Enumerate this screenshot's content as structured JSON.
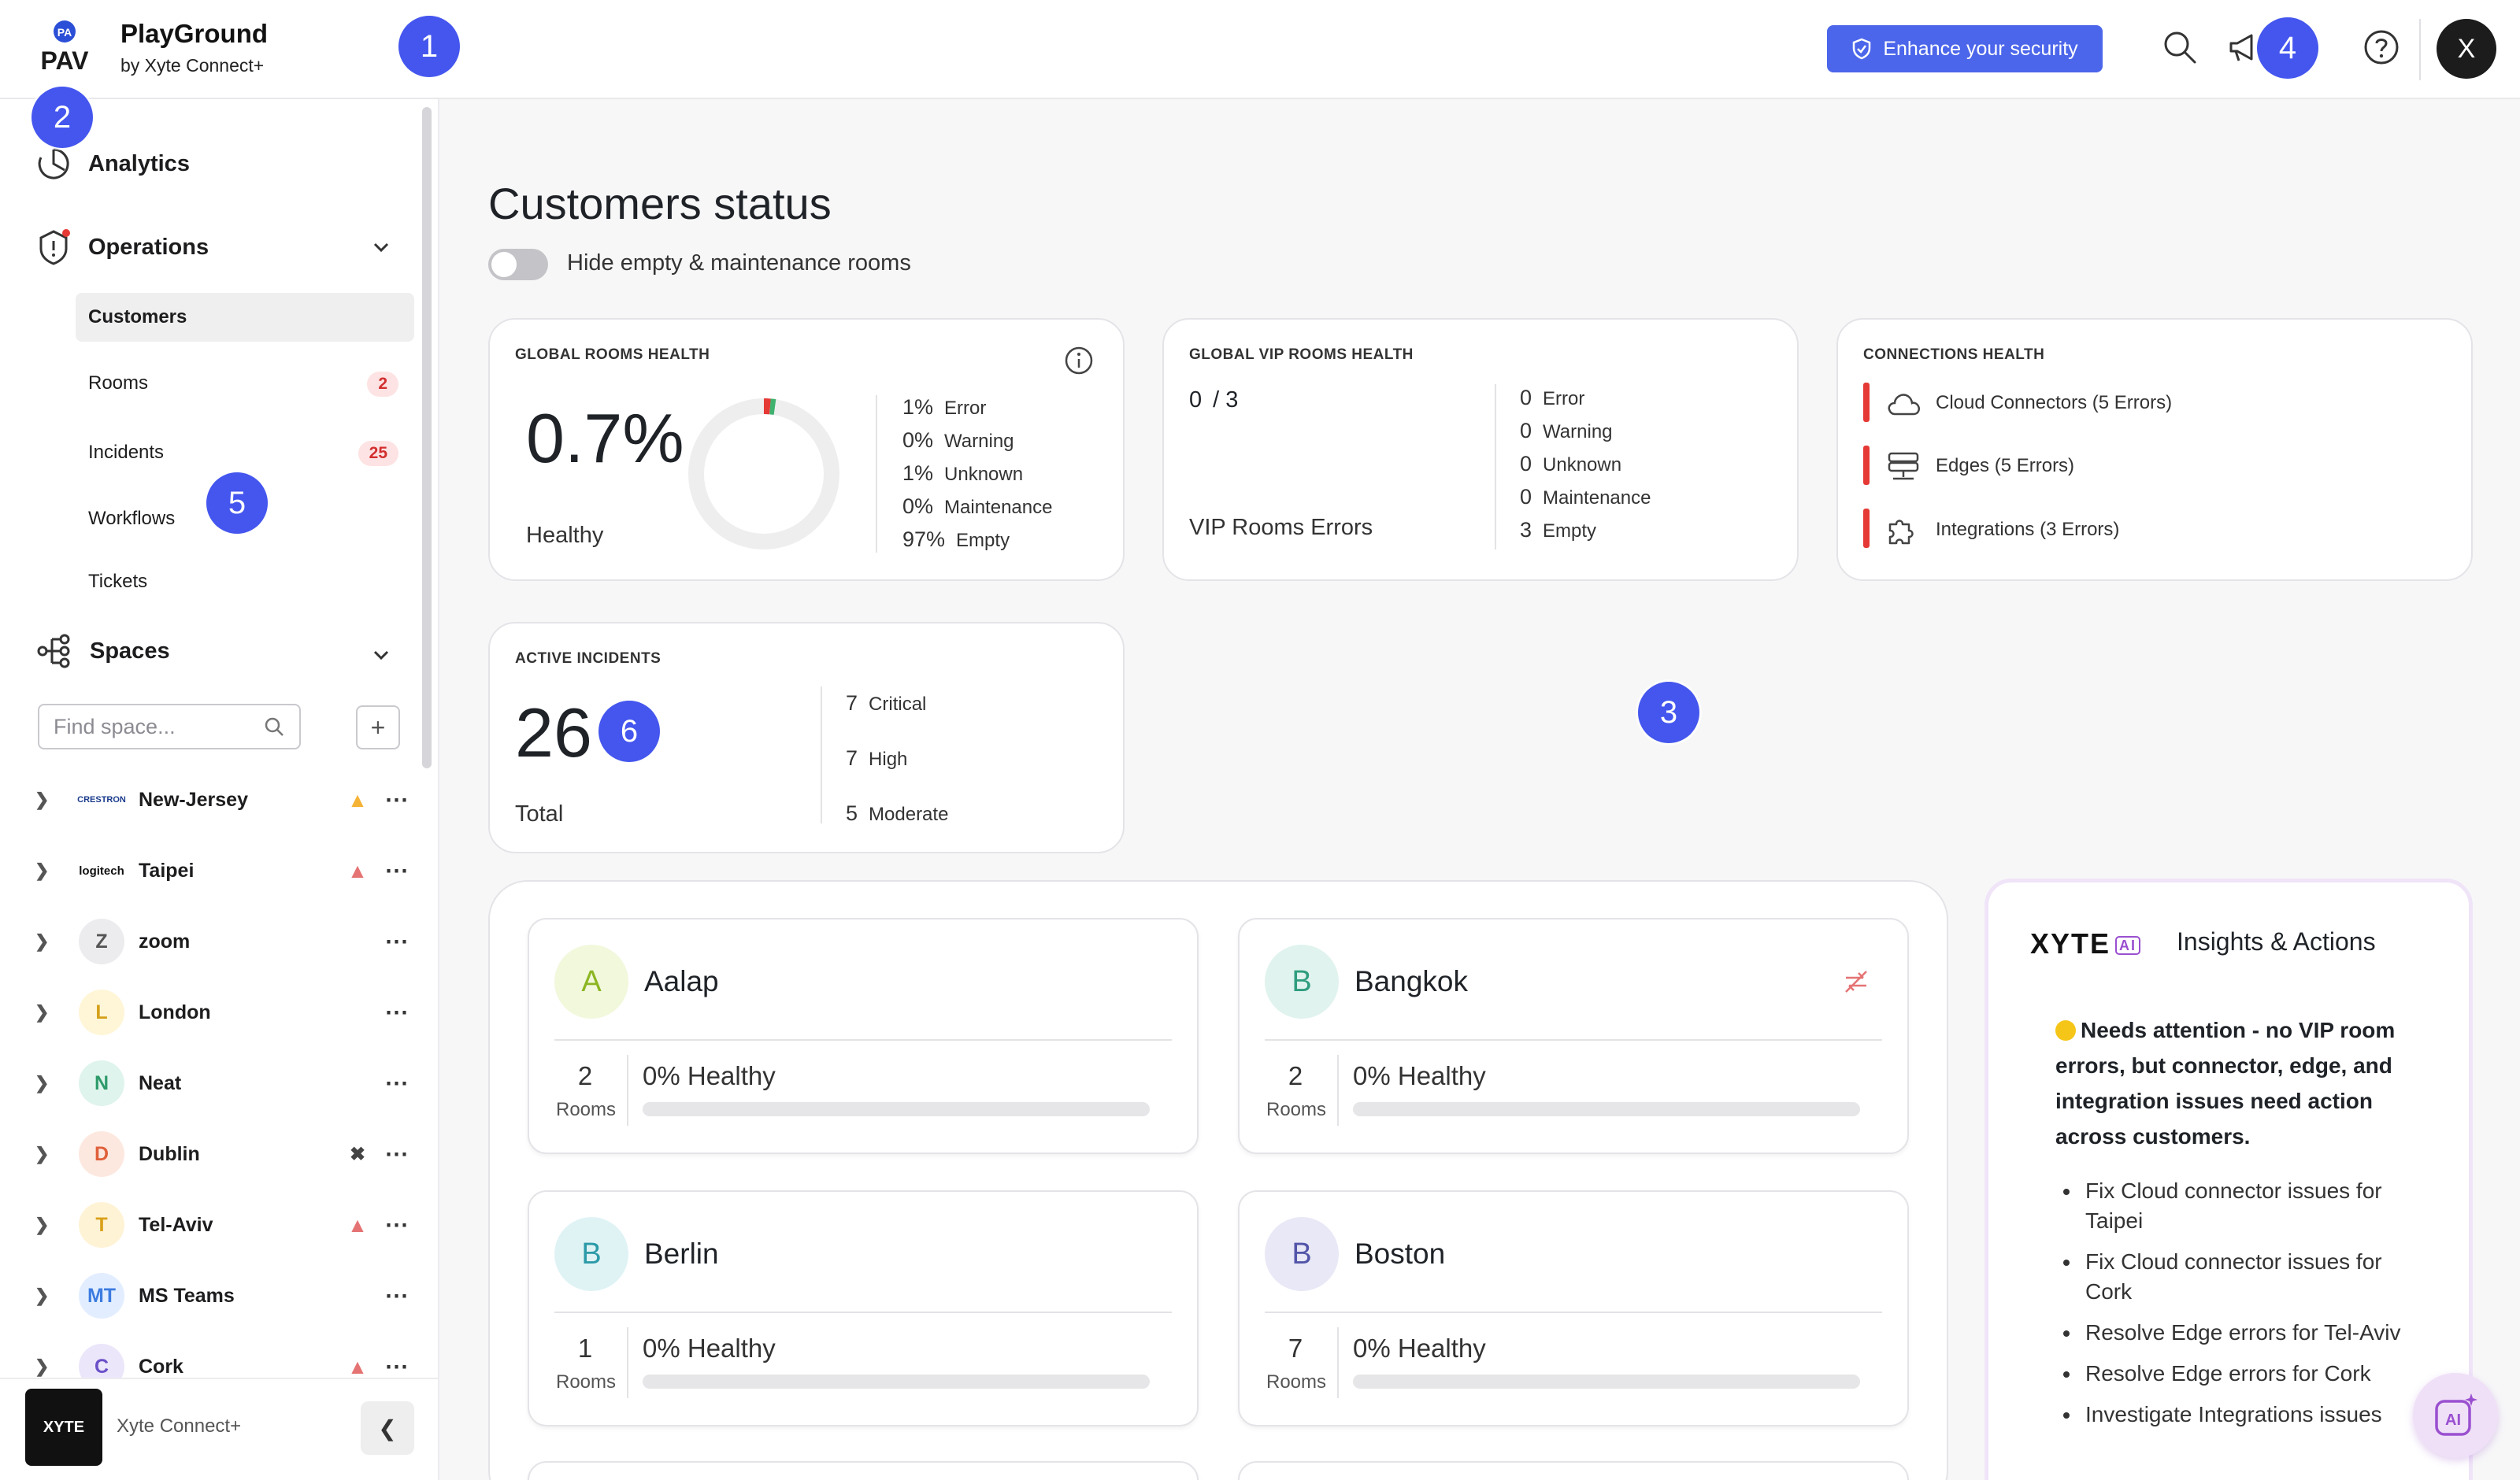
{
  "app": {
    "title": "PlayGround",
    "subtitle": "by Xyte Connect+",
    "logo_text": "PAV"
  },
  "topbar": {
    "enhance_label": "Enhance your security",
    "avatar_initial": "X",
    "icons": [
      "search-icon",
      "megaphone-icon",
      "bell-icon",
      "help-icon"
    ]
  },
  "badges": {
    "b1": "1",
    "b2": "2",
    "b3": "3",
    "b4": "4",
    "b5": "5",
    "b6": "6"
  },
  "sidebar": {
    "analytics": "Analytics",
    "operations": "Operations",
    "sub_items": [
      {
        "label": "Customers",
        "count": ""
      },
      {
        "label": "Rooms",
        "count": "2"
      },
      {
        "label": "Incidents",
        "count": "25"
      },
      {
        "label": "Workflows",
        "count": ""
      },
      {
        "label": "Tickets",
        "count": ""
      }
    ],
    "spaces": "Spaces",
    "find_placeholder": "Find space...",
    "space_items": [
      {
        "name": "New-Jersey",
        "avatar": "CRESTRON",
        "status": "warning"
      },
      {
        "name": "Taipei",
        "avatar": "logitech",
        "status": "error"
      },
      {
        "name": "zoom",
        "avatar": "Z",
        "status": ""
      },
      {
        "name": "London",
        "avatar": "L",
        "status": ""
      },
      {
        "name": "Neat",
        "avatar": "N",
        "status": ""
      },
      {
        "name": "Dublin",
        "avatar": "D",
        "status": "maintenance"
      },
      {
        "name": "Tel-Aviv",
        "avatar": "T",
        "status": "error"
      },
      {
        "name": "MS Teams",
        "avatar": "MT",
        "status": ""
      },
      {
        "name": "Cork",
        "avatar": "C",
        "status": "error"
      }
    ],
    "footer_logo": "XYTE",
    "footer_name": "Xyte Connect+"
  },
  "main": {
    "title": "Customers status",
    "toggle_label": "Hide empty & maintenance rooms",
    "global_rooms": {
      "title": "GLOBAL ROOMS HEALTH",
      "value": "0.7%",
      "label": "Healthy",
      "stats": [
        {
          "v": "1%",
          "k": "Error"
        },
        {
          "v": "0%",
          "k": "Warning"
        },
        {
          "v": "1%",
          "k": "Unknown"
        },
        {
          "v": "0%",
          "k": "Maintenance"
        },
        {
          "v": "97%",
          "k": "Empty"
        }
      ]
    },
    "vip_rooms": {
      "title": "GLOBAL VIP ROOMS HEALTH",
      "value": "0",
      "total": "/ 3",
      "label": "VIP Rooms Errors",
      "stats": [
        {
          "v": "0",
          "k": "Error"
        },
        {
          "v": "0",
          "k": "Warning"
        },
        {
          "v": "0",
          "k": "Unknown"
        },
        {
          "v": "0",
          "k": "Maintenance"
        },
        {
          "v": "3",
          "k": "Empty"
        }
      ]
    },
    "connections": {
      "title": "CONNECTIONS HEALTH",
      "items": [
        "Cloud Connectors (5 Errors)",
        "Edges (5 Errors)",
        "Integrations (3 Errors)"
      ]
    },
    "incidents": {
      "title": "ACTIVE INCIDENTS",
      "value": "26",
      "label": "Total",
      "stats": [
        {
          "v": "7",
          "k": "Critical"
        },
        {
          "v": "7",
          "k": "High"
        },
        {
          "v": "5",
          "k": "Moderate"
        }
      ]
    },
    "customers": [
      {
        "name": "Aalap",
        "initial": "A",
        "rooms": "2",
        "rooms_label": "Rooms",
        "health": "0% Healthy",
        "health_value": 0
      },
      {
        "name": "Bangkok",
        "initial": "B",
        "rooms": "2",
        "rooms_label": "Rooms",
        "health": "0% Healthy",
        "health_value": 0
      },
      {
        "name": "Berlin",
        "initial": "B",
        "rooms": "1",
        "rooms_label": "Rooms",
        "health": "0% Healthy",
        "health_value": 0
      },
      {
        "name": "Boston",
        "initial": "B",
        "rooms": "7",
        "rooms_label": "Rooms",
        "health": "0% Healthy",
        "health_value": 0
      }
    ]
  },
  "insights": {
    "logo": "XYTE",
    "title": "Insights & Actions",
    "note": "Needs attention - no VIP room errors, but connector, edge, and integration issues need action across customers.",
    "items": [
      "Fix Cloud connector issues for Taipei",
      "Fix Cloud connector issues for Cork",
      "Resolve Edge errors for Tel-Aviv",
      "Resolve Edge errors for Cork",
      "Investigate Integrations issues"
    ]
  },
  "colors": {
    "accent": "#4b66ea",
    "badge": "#4456ee",
    "error": "#e53935",
    "warning": "#f5b335"
  }
}
